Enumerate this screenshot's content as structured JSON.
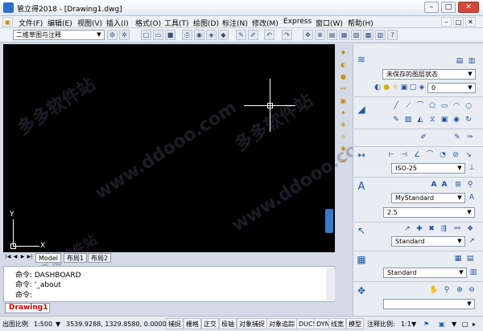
{
  "window": {
    "title": "管立得2018 - [Drawing1.dwg]",
    "min": "–",
    "max": "□",
    "close": "✕"
  },
  "menus": [
    "文件(F)",
    "编辑(E)",
    "视图(V)",
    "插入(I)",
    "格式(O)",
    "工具(T)",
    "绘图(D)",
    "标注(N)",
    "修改(M)",
    "Express",
    "窗口(W)",
    "帮助(H)"
  ],
  "mdi": {
    "min": "–",
    "max": "□",
    "close": "✕"
  },
  "workspace": {
    "value": "二维草图与注释"
  },
  "watermarks": [
    "多多软件站",
    "www.ddooo.com",
    "多多软件站",
    "www.ddooo.com",
    "多多软件站"
  ],
  "axis": {
    "x": "X",
    "y": "Y"
  },
  "layout_tabs": {
    "model": "Model",
    "layout1": "布局1",
    "layout2": "布局2"
  },
  "command": {
    "lines": [
      "命令: DASHBOARD",
      "命令: '_about",
      "命令:"
    ]
  },
  "doc_tab": "Drawing1",
  "status": {
    "scale_label": "出图比例",
    "scale_value": "1:500",
    "coords": "3539.9288, 1329.8580, 0.0000",
    "buttons": [
      "捕捉",
      "栅格",
      "正交",
      "极轴",
      "对象捕捉",
      "对象追踪",
      "DUCS",
      "DYN",
      "线宽",
      "模型"
    ],
    "annot_label": "注释比例:",
    "annot_value": "1:1"
  },
  "panel": {
    "layer_state": "未保存的图层状态",
    "layer_value": "0",
    "dim_style": "ISO-25",
    "text_style": "MyStandard",
    "text_height": "2.5",
    "mleader_style": "Standard",
    "table_style": "Standard"
  },
  "colors": {
    "canvas": "#000000",
    "accent": "#1f5aa8",
    "doc_tab": "#cc0000"
  }
}
